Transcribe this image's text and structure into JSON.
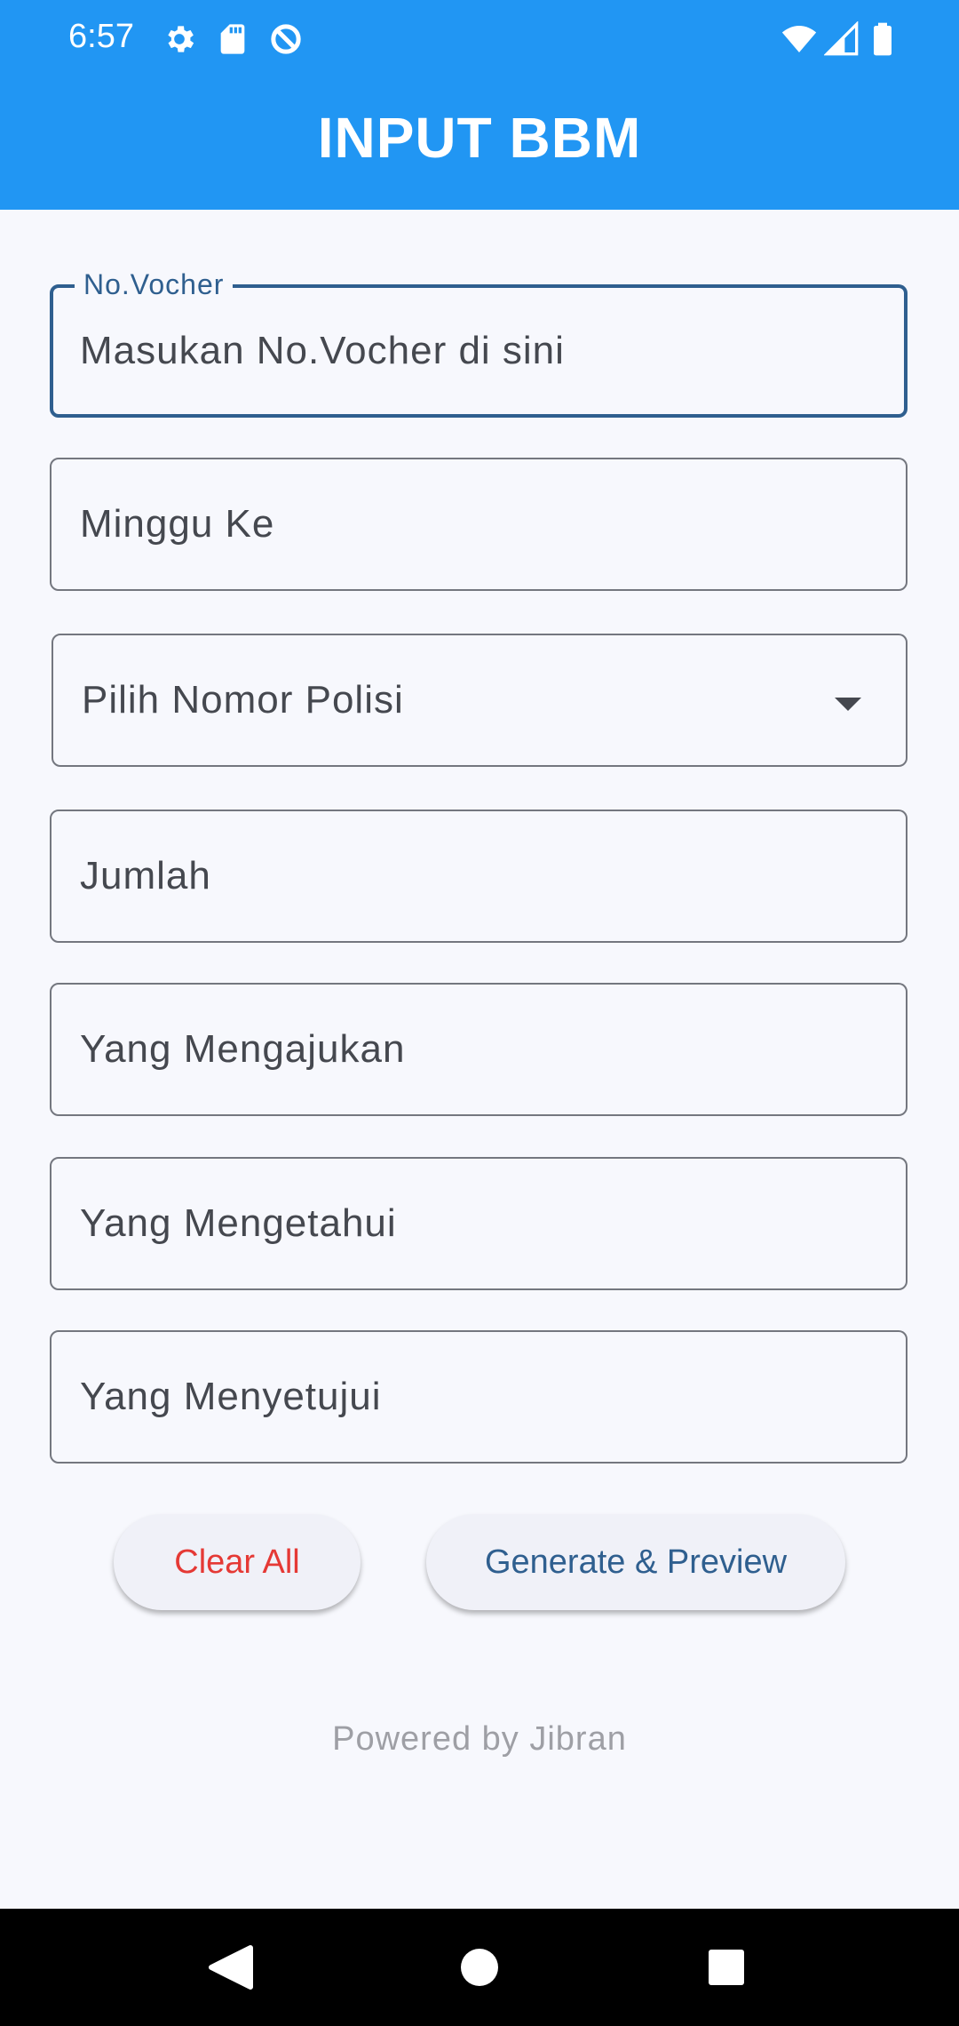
{
  "status_bar": {
    "time": "6:57",
    "left_icons": [
      "gear-icon",
      "sd-card-icon",
      "data-saver-icon"
    ],
    "right_icons": [
      "wifi-icon",
      "cell-signal-icon",
      "battery-icon"
    ]
  },
  "app_bar": {
    "title": "INPUT BBM",
    "color": "#2196F3"
  },
  "form": {
    "no_vocher": {
      "label": "No.Vocher",
      "placeholder": "Masukan No.Vocher di sini"
    },
    "minggu_ke": {
      "placeholder": "Minggu Ke"
    },
    "nomor_polisi": {
      "selected": "Pilih Nomor Polisi"
    },
    "jumlah": {
      "placeholder": "Jumlah"
    },
    "yang_mengajukan": {
      "placeholder": "Yang Mengajukan"
    },
    "yang_mengetahui": {
      "placeholder": "Yang Mengetahui"
    },
    "yang_menyetujui": {
      "placeholder": "Yang Menyetujui"
    }
  },
  "actions": {
    "clear_label": "Clear All",
    "generate_label": "Generate & Preview"
  },
  "footer": {
    "text": "Powered by Jibran"
  },
  "nav_bar": {
    "icons": [
      "back-icon",
      "home-icon",
      "recents-icon"
    ]
  }
}
